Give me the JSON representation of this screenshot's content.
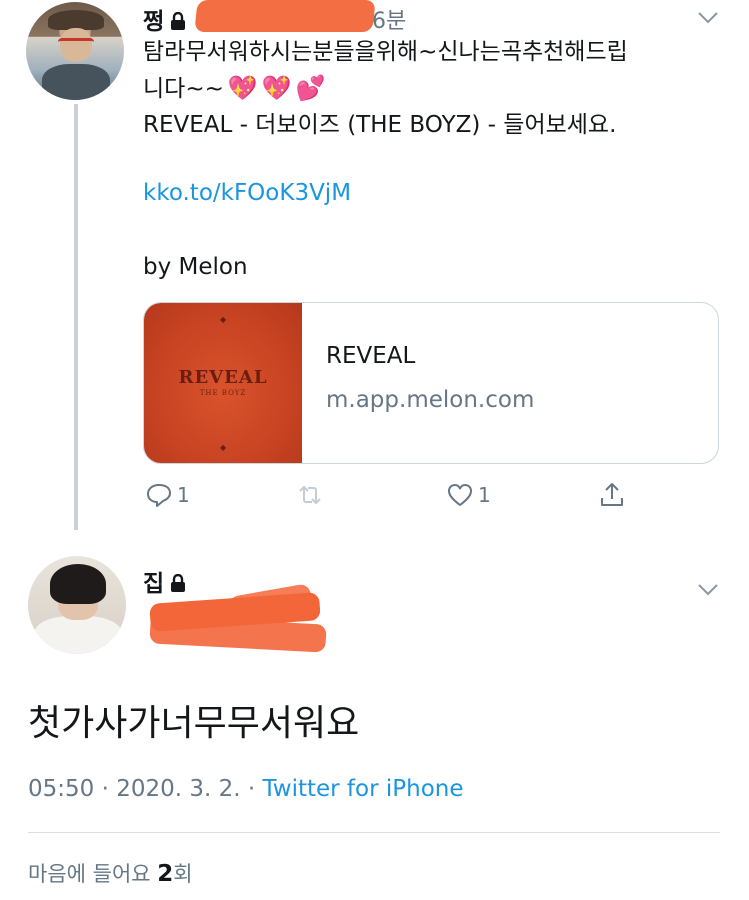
{
  "tweet1": {
    "name": "쩡",
    "time": "6분",
    "text_line1": "탐라무서워하시는분들을위해~신나는곡추천해드립",
    "text_line2": "니다~~",
    "emojis": [
      "💖",
      "💖",
      "💕"
    ],
    "text_line3": "REVEAL - 더보이즈 (THE BOYZ) - 들어보세요.",
    "link": "kko.to/kFOoK3VjM",
    "byline": "by Melon",
    "card": {
      "title": "REVEAL",
      "domain": "m.app.melon.com",
      "album_title": "REVEAL",
      "album_artist": "THE BOYZ"
    },
    "actions": {
      "reply_count": "1",
      "like_count": "1"
    }
  },
  "tweet2": {
    "name": "집",
    "text": "첫가사가너무무서워요",
    "time": "05:50",
    "date": "2020. 3. 2.",
    "separator": "·",
    "source": "Twitter for iPhone",
    "likes_prefix": "마음에 들어요 ",
    "likes_count": "2",
    "likes_suffix": "회"
  },
  "colors": {
    "link": "#1b95e0",
    "muted": "#657786",
    "text": "#14171a",
    "redaction": "#f3663a",
    "thread_line": "#c9d2da"
  },
  "icons": [
    "lock-icon",
    "chevron-down-icon",
    "reply-icon",
    "retweet-icon",
    "heart-icon",
    "share-icon"
  ]
}
